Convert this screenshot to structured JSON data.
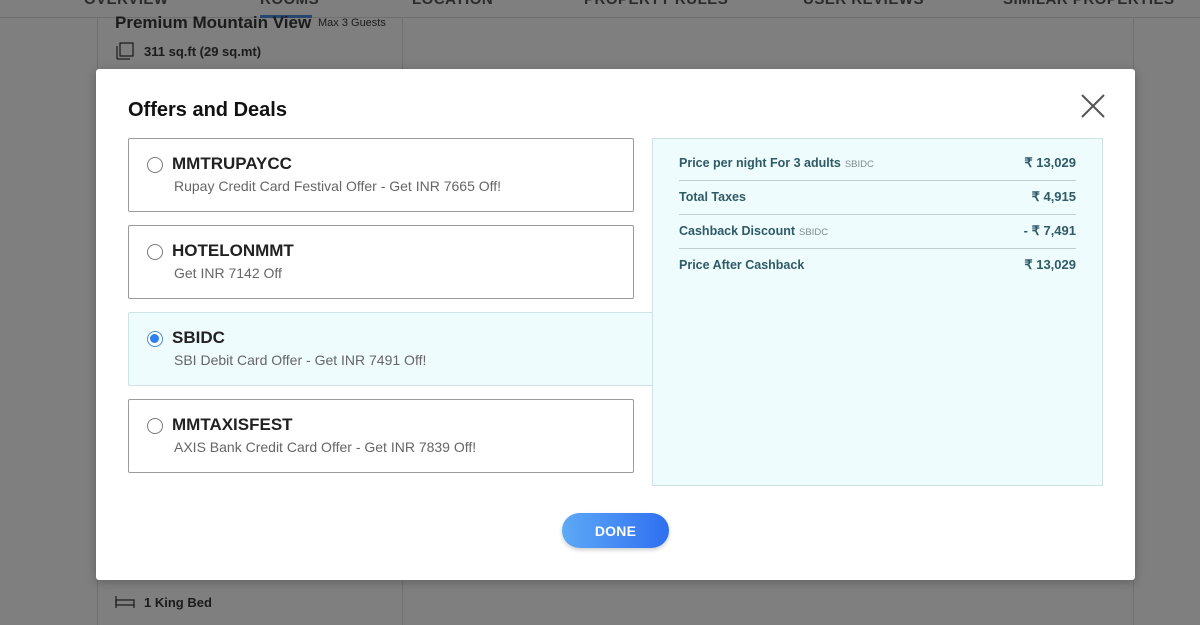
{
  "background": {
    "tabs": [
      "OVERVIEW",
      "ROOMS",
      "LOCATION",
      "PROPERTY RULES",
      "USER REVIEWS",
      "SIMILAR PROPERTIES"
    ],
    "room_title": "Premium Mountain View",
    "max_guests": "Max  3 Guests",
    "area": "311 sq.ft (29 sq.mt)",
    "bed": "1 King Bed"
  },
  "modal": {
    "title": "Offers and Deals",
    "close_icon": "close-icon",
    "offers": [
      {
        "code": "MMTRUPAYCC",
        "description": "Rupay Credit Card Festival Offer - Get INR 7665 Off!",
        "selected": false
      },
      {
        "code": "HOTELONMMT",
        "description": "Get INR 7142 Off",
        "selected": false
      },
      {
        "code": "SBIDC",
        "description": "SBI Debit Card Offer - Get INR 7491 Off!",
        "selected": true
      },
      {
        "code": "MMTAXISFEST",
        "description": "AXIS Bank Credit Card Offer - Get INR 7839 Off!",
        "selected": false
      }
    ],
    "price_breakdown": [
      {
        "label": "Price per night For 3 adults",
        "tag": "SBIDC",
        "value": "₹ 13,029"
      },
      {
        "label": "Total Taxes",
        "tag": "",
        "value": "₹ 4,915"
      },
      {
        "label": "Cashback Discount",
        "tag": "SBIDC",
        "value": "- ₹ 7,491"
      },
      {
        "label": "Price After Cashback",
        "tag": "",
        "value": "₹ 13,029"
      }
    ],
    "done_label": "DONE"
  },
  "colors": {
    "accent": "#2e6ff0",
    "selected_bg": "#eefcfd",
    "price_text": "#2f5a66"
  }
}
